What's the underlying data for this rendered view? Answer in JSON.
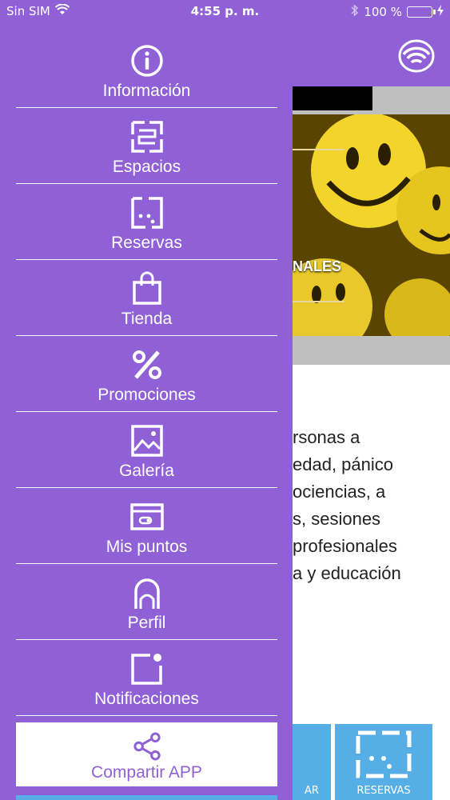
{
  "status_bar": {
    "carrier": "Sin SIM",
    "time": "4:55 p. m.",
    "battery": "100 %"
  },
  "colors": {
    "drawer_bg": "#9061d6",
    "accent_blue": "#55aee6",
    "text_white": "#ffffff"
  },
  "menu": {
    "items": [
      {
        "label": "Información",
        "icon": "info-icon"
      },
      {
        "label": "Espacios",
        "icon": "spaces-icon"
      },
      {
        "label": "Reservas",
        "icon": "reservations-icon"
      },
      {
        "label": "Tienda",
        "icon": "shopping-bag-icon"
      },
      {
        "label": "Promociones",
        "icon": "percent-icon"
      },
      {
        "label": "Galería",
        "icon": "gallery-icon"
      },
      {
        "label": "Mis puntos",
        "icon": "points-card-icon"
      },
      {
        "label": "Perfil",
        "icon": "profile-icon"
      },
      {
        "label": "Notificaciones",
        "icon": "notification-icon"
      },
      {
        "label": "Compartir APP",
        "icon": "share-icon"
      }
    ]
  },
  "background": {
    "hero_label": "NALES",
    "body_lines": [
      "rsonas a",
      "edad, pánico",
      "ociencias, a",
      "s, sesiones",
      "profesionales",
      "a y educación"
    ],
    "tiles": [
      {
        "label": "AR"
      },
      {
        "label": "RESERVAS"
      }
    ]
  }
}
